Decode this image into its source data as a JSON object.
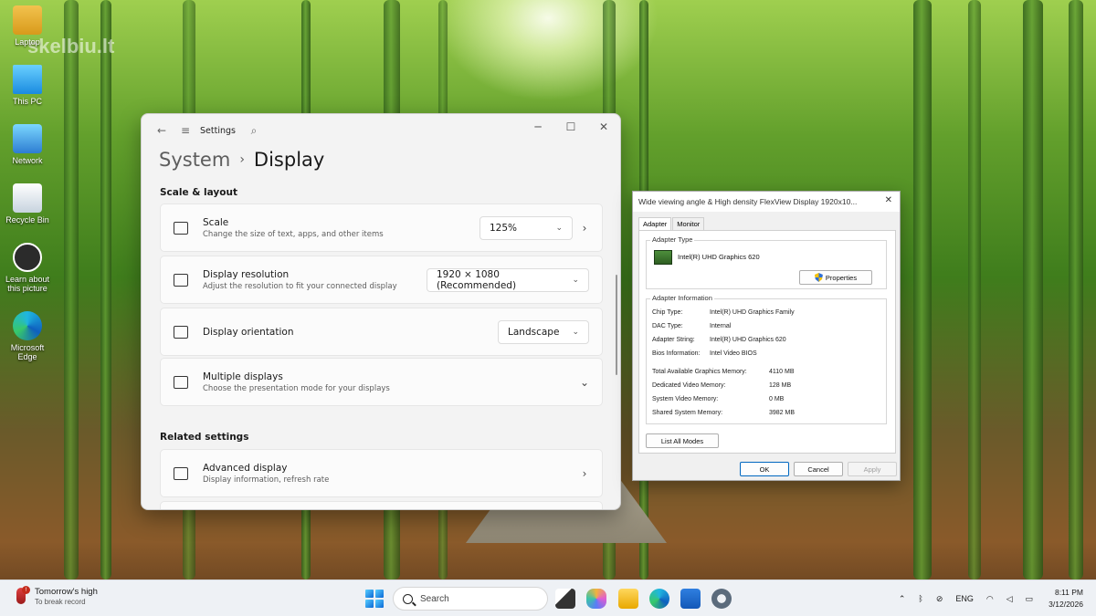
{
  "desktop": {
    "watermark": "skelbiu.lt",
    "icons": [
      {
        "label": "Laptop",
        "icon": "user-folder-icon"
      },
      {
        "label": "This PC",
        "icon": "monitor-icon"
      },
      {
        "label": "Network",
        "icon": "network-icon"
      },
      {
        "label": "Recycle Bin",
        "icon": "recycle-bin-icon"
      },
      {
        "label": "Learn about this picture",
        "icon": "camera-icon"
      },
      {
        "label": "Microsoft Edge",
        "icon": "edge-icon"
      }
    ]
  },
  "settings": {
    "app_title": "Settings",
    "breadcrumb": {
      "parent": "System",
      "sep": "›",
      "current": "Display"
    },
    "sections": {
      "scale_layout": "Scale & layout",
      "related": "Related settings"
    },
    "cards": {
      "scale": {
        "title": "Scale",
        "subtitle": "Change the size of text, apps, and other items",
        "value": "125%"
      },
      "resolution": {
        "title": "Display resolution",
        "subtitle": "Adjust the resolution to fit your connected display",
        "value": "1920 × 1080 (Recommended)"
      },
      "orientation": {
        "title": "Display orientation",
        "value": "Landscape"
      },
      "multiple": {
        "title": "Multiple displays",
        "subtitle": "Choose the presentation mode for your displays"
      },
      "advanced": {
        "title": "Advanced display",
        "subtitle": "Display information, refresh rate"
      }
    }
  },
  "dialog": {
    "title": "Wide viewing angle & High density FlexView Display 1920x10...",
    "tabs": [
      "Adapter",
      "Monitor"
    ],
    "adapter_type": {
      "label": "Adapter Type",
      "name": "Intel(R) UHD Graphics 620",
      "properties_button": "Properties"
    },
    "adapter_info": {
      "label": "Adapter Information",
      "rows": [
        {
          "key": "Chip Type:",
          "value": "Intel(R) UHD Graphics Family"
        },
        {
          "key": "DAC Type:",
          "value": "Internal"
        },
        {
          "key": "Adapter String:",
          "value": "Intel(R) UHD Graphics 620"
        },
        {
          "key": "Bios Information:",
          "value": "Intel Video BIOS"
        }
      ],
      "memory": [
        {
          "key": "Total Available Graphics Memory:",
          "value": "4110 MB"
        },
        {
          "key": "Dedicated Video Memory:",
          "value": "128 MB"
        },
        {
          "key": "System Video Memory:",
          "value": "0 MB"
        },
        {
          "key": "Shared System Memory:",
          "value": "3982 MB"
        }
      ]
    },
    "list_modes_button": "List All Modes",
    "buttons": {
      "ok": "OK",
      "cancel": "Cancel",
      "apply": "Apply"
    }
  },
  "taskbar": {
    "weather": {
      "line1": "Tomorrow's high",
      "line2": "To break record",
      "badge": "!"
    },
    "search_placeholder": "Search",
    "tray": {
      "language": "ENG",
      "time": "8:11 PM",
      "date": "3/12/2026"
    }
  }
}
